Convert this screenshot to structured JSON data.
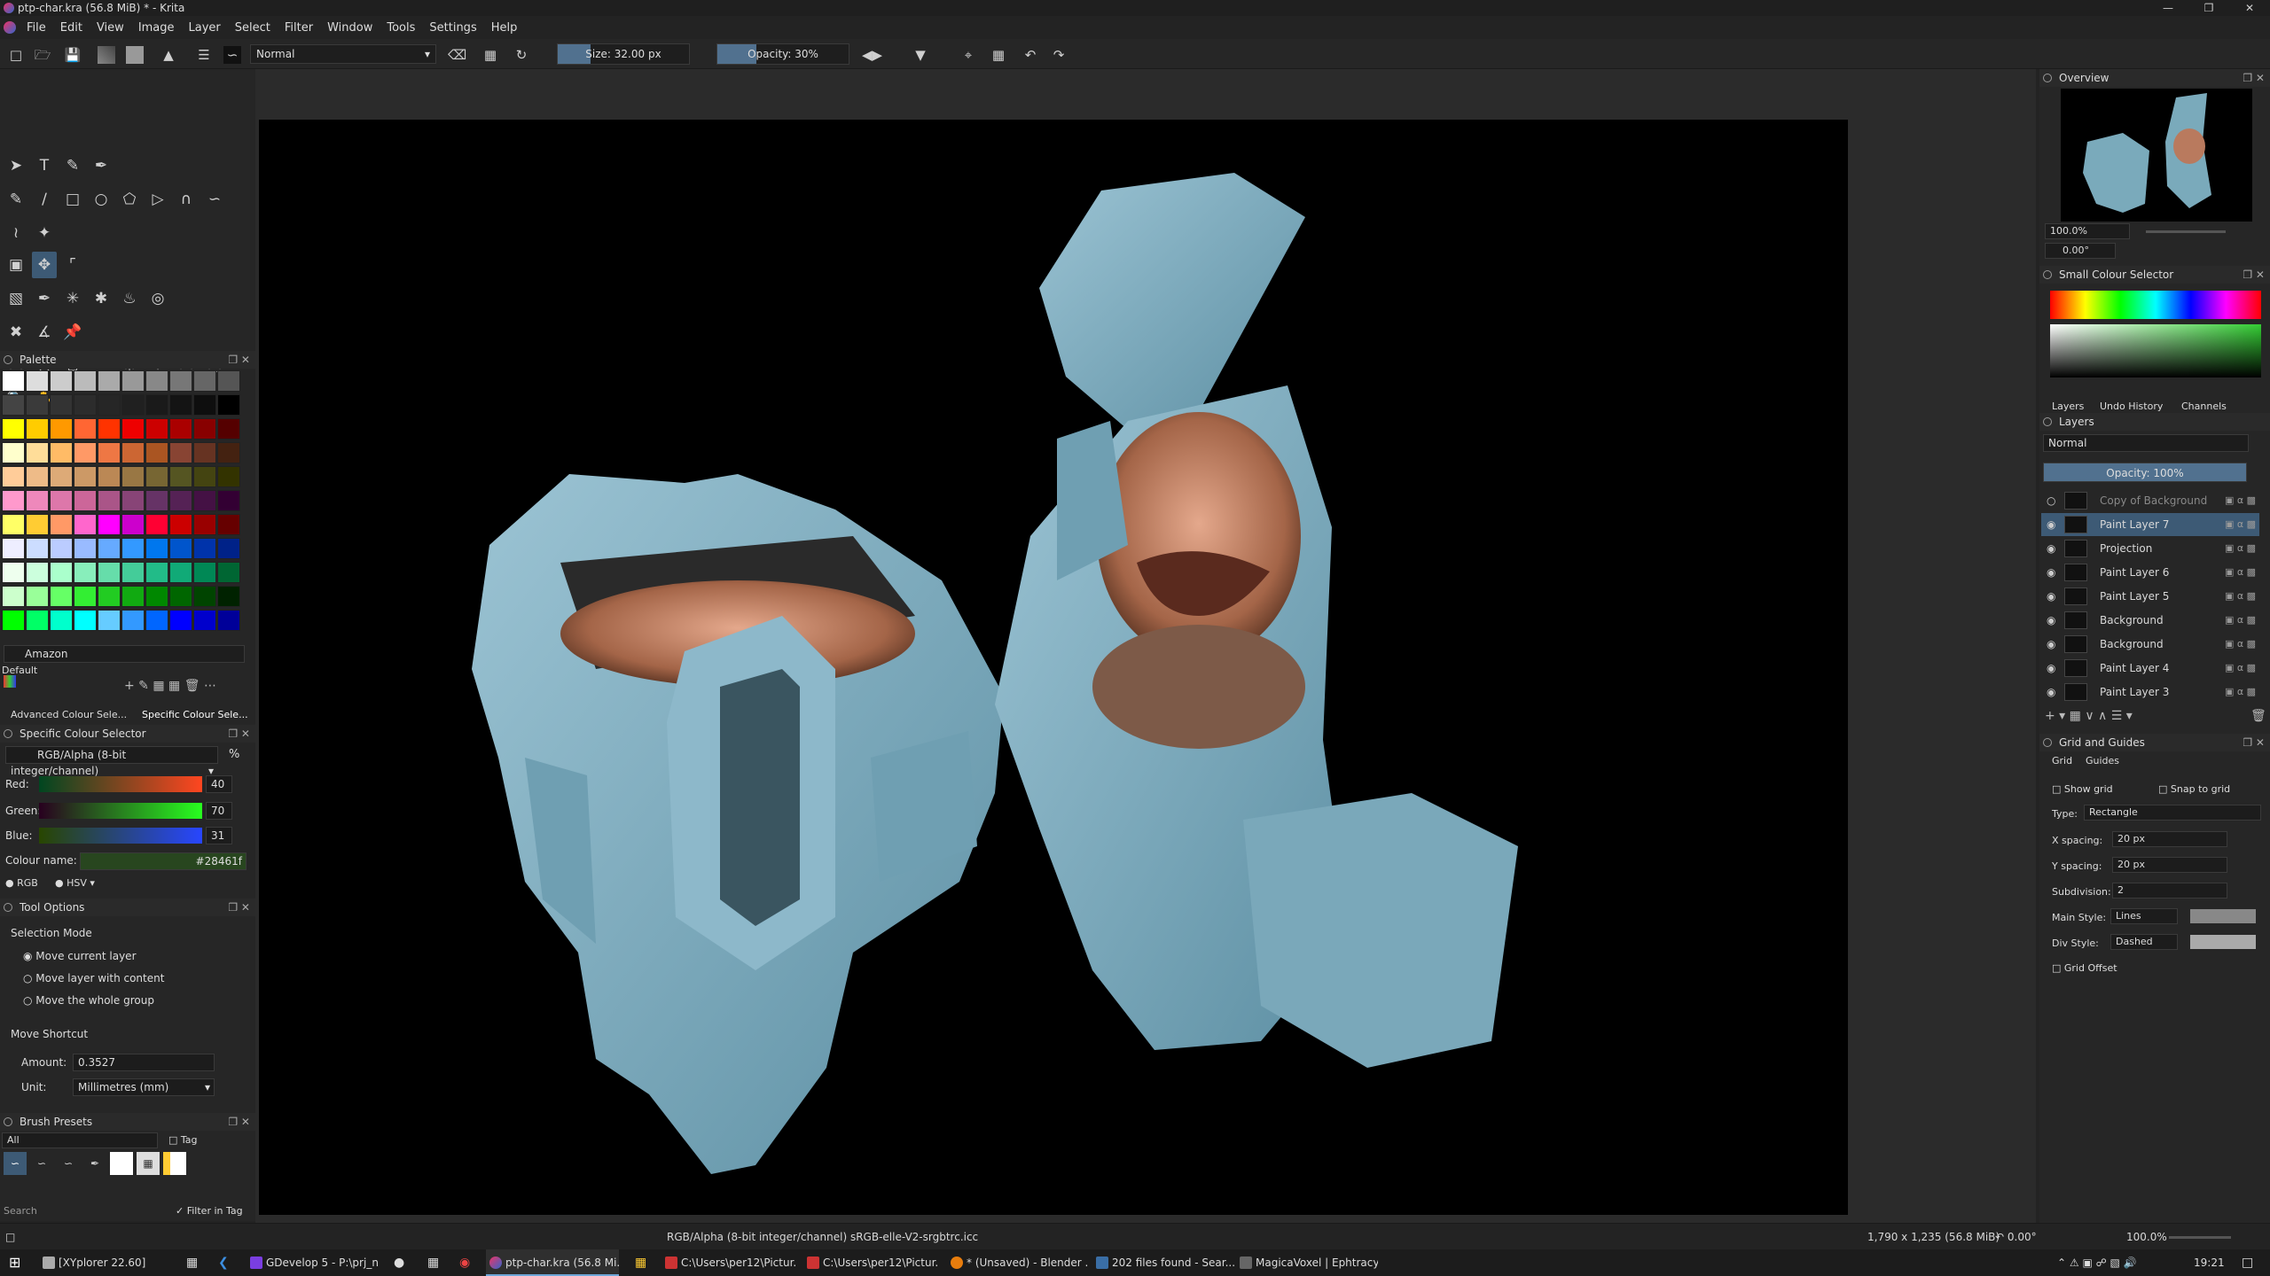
{
  "window": {
    "title": "ptp-char.kra (56.8 MiB) * - Krita"
  },
  "menu": [
    "File",
    "Edit",
    "View",
    "Image",
    "Layer",
    "Select",
    "Filter",
    "Window",
    "Tools",
    "Settings",
    "Help"
  ],
  "toolbar": {
    "blend_mode": "Normal",
    "size": "Size: 32.00 px",
    "opacity": "Opacity: 30%"
  },
  "palette": {
    "title": "Palette",
    "name": "Amazon",
    "set": "Default"
  },
  "colour_tabs": [
    "Advanced Colour Sele...",
    "Specific Colour Sele..."
  ],
  "specific_colour": {
    "title": "Specific Colour Selector",
    "model": "RGB/Alpha (8-bit integer/channel)",
    "percent": "%",
    "red_label": "Red:",
    "red": "40",
    "green_label": "Green:",
    "green": "70",
    "blue_label": "Blue:",
    "blue": "31",
    "name_label": "Colour name:",
    "name": "#28461f",
    "rgb": "RGB",
    "hsv": "HSV"
  },
  "tool_options": {
    "title": "Tool Options",
    "selection_mode": "Selection Mode",
    "opt1": "Move current layer",
    "opt2": "Move layer with content",
    "opt3": "Move the whole group",
    "move_shortcut": "Move Shortcut",
    "amount_label": "Amount:",
    "amount": "0.3527",
    "unit_label": "Unit:",
    "unit": "Millimetres (mm)"
  },
  "brush_presets": {
    "title": "Brush Presets",
    "filter": "All",
    "tag": "Tag",
    "search": "Search",
    "filter_in_tag": "Filter in Tag"
  },
  "overview": {
    "title": "Overview",
    "zoom": "100.0%",
    "rotation": "0.00°"
  },
  "small_colour": {
    "title": "Small Colour Selector"
  },
  "layer_tabs": [
    "Layers",
    "Undo History",
    "Channels"
  ],
  "layers": {
    "title": "Layers",
    "blend": "Normal",
    "opacity": "Opacity:  100%",
    "items": [
      "Copy of Background",
      "Paint Layer 7",
      "Projection",
      "Paint Layer 6",
      "Paint Layer 5",
      "Background",
      "Background",
      "Paint Layer 4",
      "Paint Layer 3"
    ]
  },
  "grid": {
    "title": "Grid and Guides",
    "tab_grid": "Grid",
    "tab_guides": "Guides",
    "show_grid": "Show grid",
    "snap": "Snap to grid",
    "type_label": "Type:",
    "type": "Rectangle",
    "xs_label": "X spacing:",
    "xs": "20 px",
    "ys_label": "Y spacing:",
    "ys": "20 px",
    "sub_label": "Subdivision:",
    "sub": "2",
    "main_label": "Main Style:",
    "main": "Lines",
    "div_label": "Div Style:",
    "div": "Dashed",
    "offset": "Grid Offset"
  },
  "status": {
    "profile": "RGB/Alpha (8-bit integer/channel)  sRGB-elle-V2-srgbtrc.icc",
    "size": "1,790 x 1,235 (56.8 MiB)",
    "rotation": "0.00°",
    "zoom": "100.0%"
  },
  "taskbar": {
    "items": [
      "[XYplorer 22.60]",
      "GDevelop 5 - P:\\prj_n...",
      "ptp-char.kra (56.8 Mi...",
      "C:\\Users\\per12\\Pictur...",
      "C:\\Users\\per12\\Pictur...",
      "* (Unsaved) - Blender ...",
      "202 files found - Sear...",
      "MagicaVoxel | Ephtracy"
    ],
    "time": "19:21"
  },
  "colors": {
    "accent": "#51718f",
    "fg_colour": "#28461f",
    "armor": "#7aaabb"
  }
}
